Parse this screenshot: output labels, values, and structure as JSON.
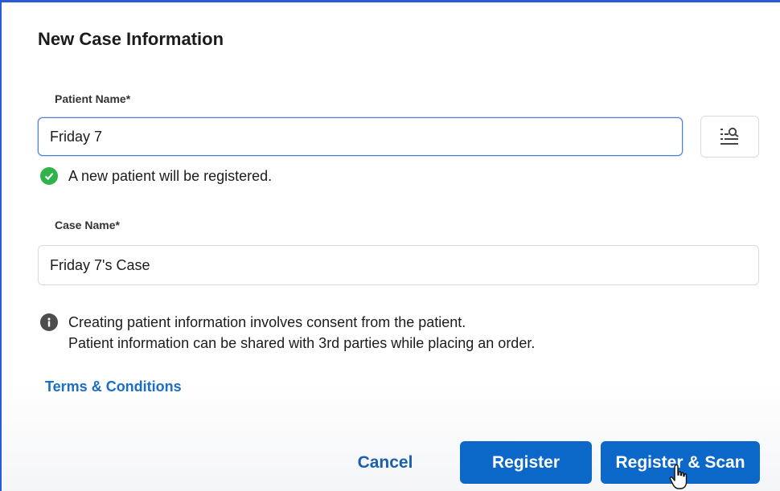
{
  "dialog": {
    "title": "New Case Information"
  },
  "patient": {
    "label": "Patient Name*",
    "value": "Friday 7",
    "status_message": "A new patient will be registered."
  },
  "case": {
    "label": "Case Name*",
    "value": "Friday 7's Case"
  },
  "notice": {
    "line1": "Creating patient information involves consent from the patient.",
    "line2": "Patient information can be shared with 3rd parties while placing an order."
  },
  "links": {
    "terms": "Terms & Conditions"
  },
  "buttons": {
    "cancel": "Cancel",
    "register": "Register",
    "register_scan": "Register & Scan"
  },
  "icons": {
    "patient_search": "list-search-icon",
    "status": "check-circle-icon",
    "notice": "info-circle-icon",
    "pointer": "hand-pointer-icon"
  },
  "colors": {
    "primary": "#0c68c8",
    "link": "#1a6ec4",
    "success": "#2fb34a",
    "focus_border": "#4a7fd4",
    "window_border": "#2a5bd7"
  }
}
